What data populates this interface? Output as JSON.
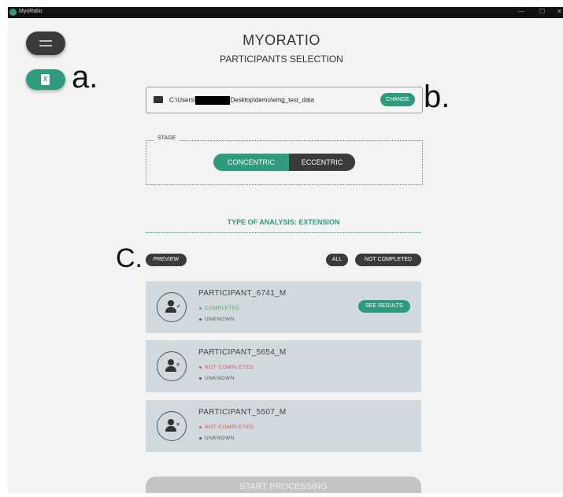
{
  "window": {
    "title": "MyoRatio",
    "minimize_glyph": "—",
    "maximize_glyph": "☐",
    "close_glyph": "✕"
  },
  "header": {
    "title": "MYORATIO",
    "subtitle": "PARTICIPANTS SELECTION"
  },
  "annotations": {
    "a": "a.",
    "b": "b.",
    "c": "C."
  },
  "sidebar": {
    "menu_icon": "hamburger-icon",
    "excel_icon": "excel-icon",
    "excel_glyph": "X"
  },
  "path": {
    "prefix": "C:\\Users\\",
    "suffix": "Desktop\\demo\\emg_test_data",
    "change_label": "CHANGE",
    "folder_icon": "folder-icon"
  },
  "stage": {
    "label": "STAGE",
    "options": [
      "CONCENTRIC",
      "ECCENTRIC"
    ],
    "selected": "CONCENTRIC"
  },
  "analysis": {
    "label": "TYPE OF ANALYSIS: EXTENSION"
  },
  "filters": {
    "preview_label": "PREVIEW",
    "all_label": "ALL",
    "not_completed_label": "NOT COMPLETED"
  },
  "participants": [
    {
      "name": "PARTICIPANT_6741_M",
      "status": "COMPLETED",
      "sub": "UNKNOWN",
      "icon_mark": "✓",
      "action": "SEE RESULTS"
    },
    {
      "name": "PARTICIPANT_5654_M",
      "status": "NOT COMPLETED",
      "sub": "UNKNOWN",
      "icon_mark": "×"
    },
    {
      "name": "PARTICIPANT_5507_M",
      "status": "NOT COMPLETED",
      "sub": "UNKNOWN",
      "icon_mark": "×"
    }
  ],
  "footer": {
    "start_label": "START PROCESSING"
  },
  "colors": {
    "accent": "#2e9b7c",
    "dark": "#3a3a3a",
    "completed": "#45a86a",
    "not_completed": "#d9534f",
    "card_bg": "#d2d9dc"
  }
}
